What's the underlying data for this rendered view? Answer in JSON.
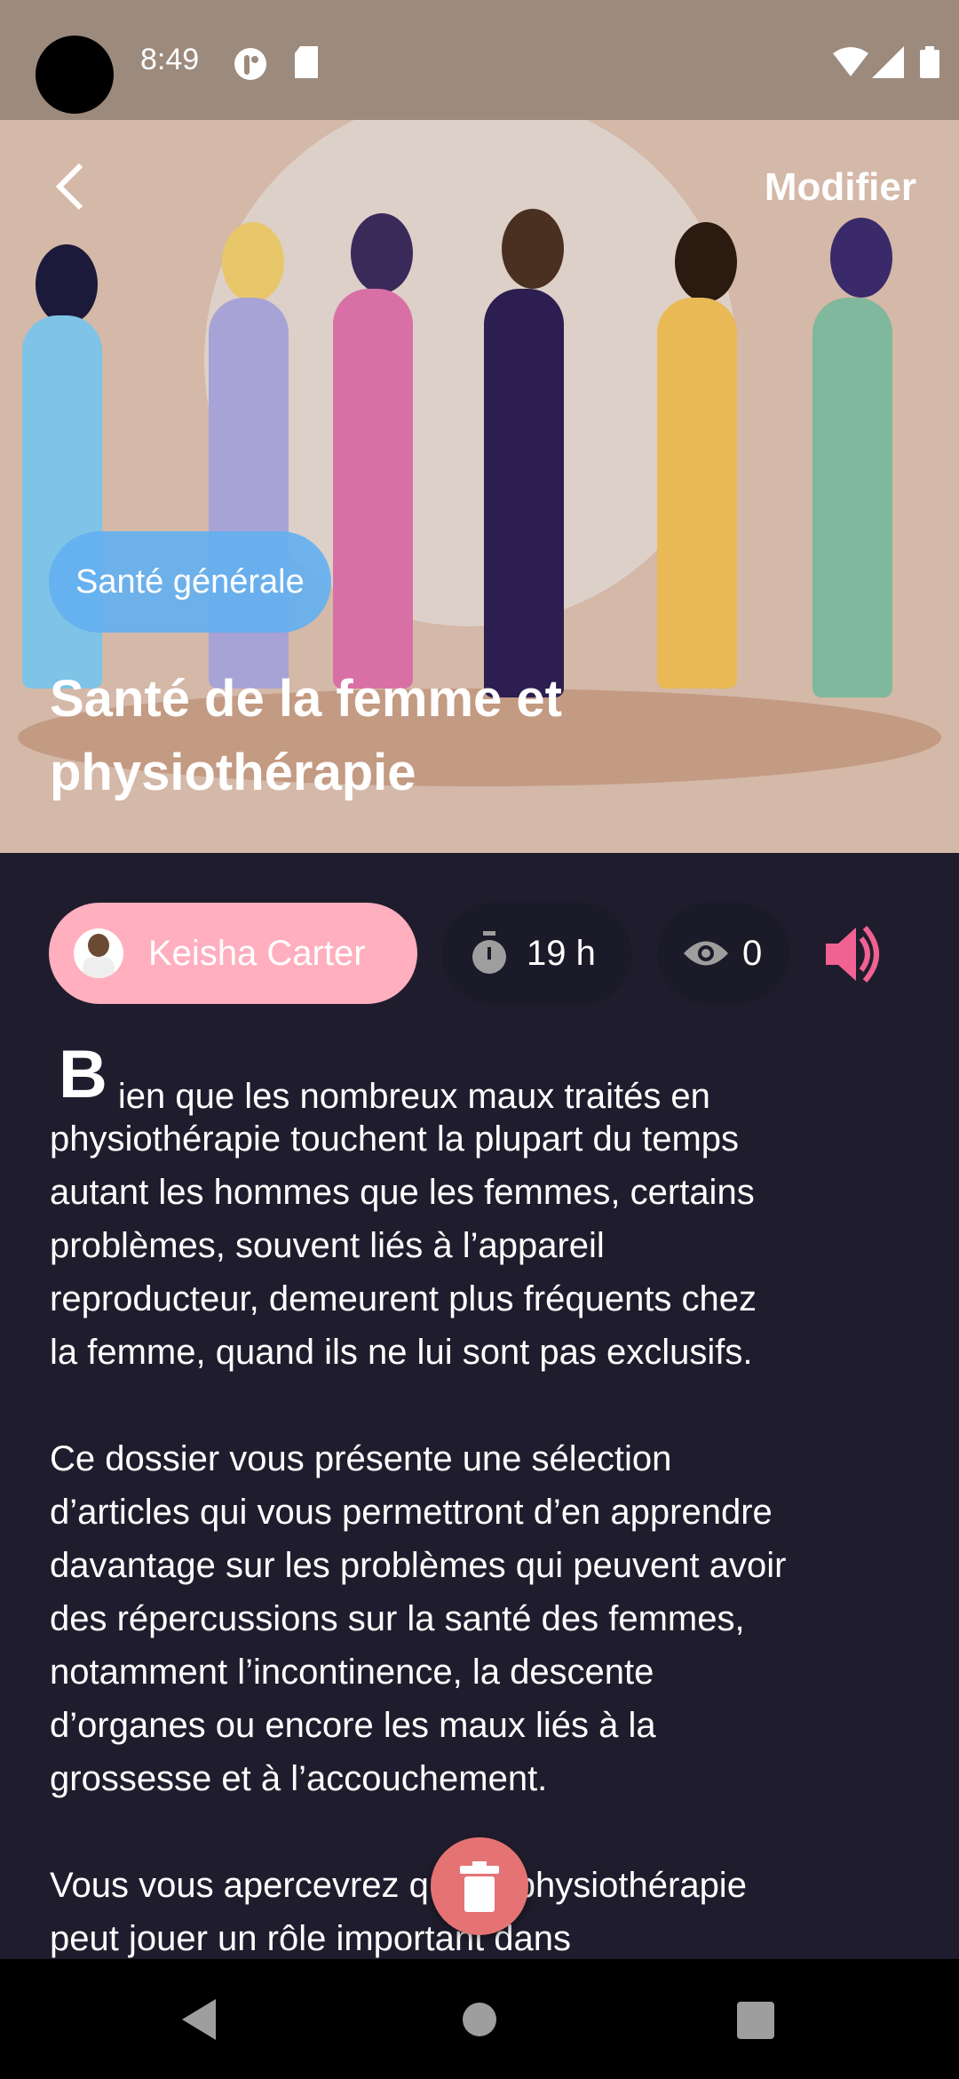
{
  "status_bar": {
    "time": "8:49"
  },
  "header": {
    "back_icon": "arrow-back-icon",
    "edit_label": "Modifier"
  },
  "hero": {
    "category": "Santé générale",
    "title": "Santé de la femme et physiothérapie"
  },
  "meta": {
    "author": "Keisha Carter",
    "duration": "19 h",
    "views": "0",
    "audio_icon": "volume-up-icon"
  },
  "body": {
    "drop_cap": "B",
    "paragraphs": [
      [
        "ien que les nombreux maux traités en",
        "physiothérapie touchent la plupart du temps",
        "autant les hommes que les femmes, certains",
        "problèmes, souvent liés à l’appareil",
        "reproducteur, demeurent plus fréquents chez",
        "la femme, quand ils ne lui sont pas exclusifs."
      ],
      [
        "Ce dossier vous présente une sélection",
        "d’articles qui vous permettront d’en apprendre",
        "davantage sur les problèmes qui peuvent avoir",
        "des répercussions sur la santé des femmes,",
        "notamment l’incontinence, la descente",
        "d’organes ou encore les maux liés à la",
        "grossesse et à l’accouchement."
      ],
      [
        "Vous vous apercevrez que la physiothérapie",
        "peut jouer un rôle important dans"
      ]
    ]
  },
  "colors": {
    "accent": "#f06292",
    "author_chip": "#ffafbe",
    "category_chip": "#64b0f0",
    "delete": "#e57373",
    "background": "#1f1d2d"
  }
}
